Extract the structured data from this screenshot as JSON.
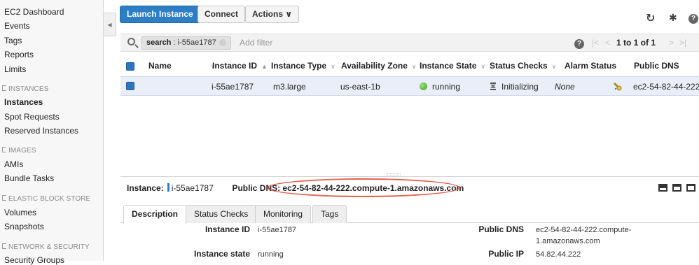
{
  "sidebar": {
    "dashboard": "EC2 Dashboard",
    "events": "Events",
    "tags": "Tags",
    "reports": "Reports",
    "limits": "Limits",
    "sections": {
      "instances": "INSTANCES",
      "images": "IMAGES",
      "ebs": "ELASTIC BLOCK STORE",
      "network": "NETWORK & SECURITY"
    },
    "instances_items": [
      "Instances",
      "Spot Requests",
      "Reserved Instances"
    ],
    "images_items": [
      "AMIs",
      "Bundle Tasks"
    ],
    "ebs_items": [
      "Volumes",
      "Snapshots"
    ],
    "network_items": [
      "Security Groups"
    ]
  },
  "toolbar": {
    "launch": "Launch Instance",
    "connect": "Connect",
    "actions": "Actions ∨",
    "refresh_icon": "↻",
    "gear_icon": "✱",
    "help_icon": "?"
  },
  "filter": {
    "key": "search",
    "value": ": i-55ae1787",
    "add_filter_placeholder": "Add filter",
    "help": "?",
    "page_count": "1 to 1 of 1",
    "first": "|<",
    "prev": "<",
    "next": ">",
    "last": ">|"
  },
  "table": {
    "headers": [
      "Name",
      "Instance ID",
      "Instance Type",
      "Availability Zone",
      "Instance State",
      "Status Checks",
      "Alarm Status",
      "Public DNS"
    ],
    "row": {
      "name": "",
      "instance_id": "i-55ae1787",
      "instance_type": "m3.large",
      "availability_zone": "us-east-1b",
      "instance_state": "running",
      "status_checks": "Initializing",
      "alarm_status": "None",
      "public_dns": "ec2-54-82-44-222.c"
    }
  },
  "detail": {
    "instance_label": "Instance:",
    "instance_id": "i-55ae1787",
    "dns_label": "Public DNS",
    "dns_value": ": ec2-54-82-44-222.compute-1.amazonaws.com",
    "tabs": [
      "Description",
      "Status Checks",
      "Monitoring",
      "Tags"
    ],
    "fields": {
      "instance_id_label": "Instance ID",
      "instance_id_value": "i-55ae1787",
      "instance_state_label": "Instance state",
      "instance_state_value": "running",
      "public_dns_label": "Public DNS",
      "public_dns_value_line1": "ec2-54-82-44-222.compute-",
      "public_dns_value_line2": "1.amazonaws.com",
      "public_ip_label": "Public IP",
      "public_ip_value": "54.82.44.222"
    }
  },
  "colors": {
    "primary": "#2d7ec4",
    "annotation": "#e4604f",
    "selected_row": "#e9eef8",
    "running": "#3aa51e"
  }
}
